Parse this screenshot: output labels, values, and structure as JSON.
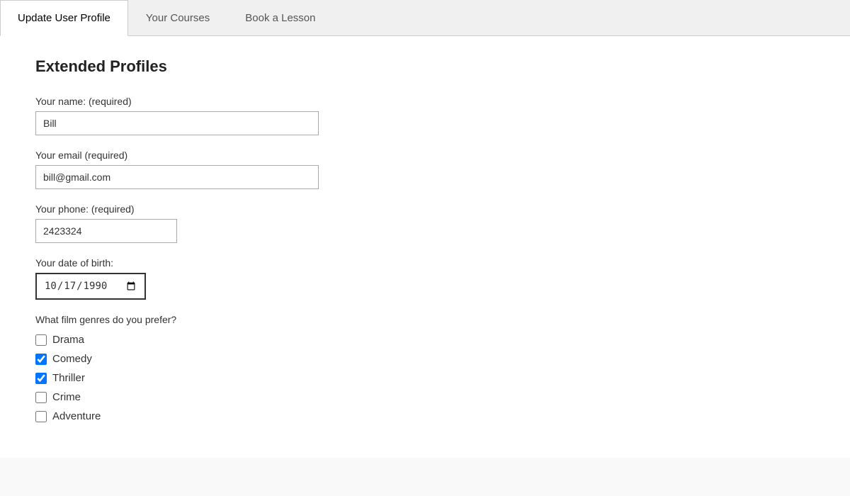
{
  "tabs": [
    {
      "id": "update-user-profile",
      "label": "Update User Profile",
      "active": true
    },
    {
      "id": "your-courses",
      "label": "Your Courses",
      "active": false
    },
    {
      "id": "book-a-lesson",
      "label": "Book a Lesson",
      "active": false
    }
  ],
  "page_title": "Extended Profiles",
  "form": {
    "name_label": "Your name: (required)",
    "name_value": "Bill",
    "email_label": "Your email (required)",
    "email_value": "bill@gmail.com",
    "phone_label": "Your phone: (required)",
    "phone_value": "2423324",
    "dob_label": "Your date of birth:",
    "dob_value": "1990-10-17",
    "dob_display": "10/17/1990",
    "genres_label": "What film genres do you prefer?",
    "genres": [
      {
        "id": "drama",
        "label": "Drama",
        "checked": false
      },
      {
        "id": "comedy",
        "label": "Comedy",
        "checked": true
      },
      {
        "id": "thriller",
        "label": "Thriller",
        "checked": true
      },
      {
        "id": "crime",
        "label": "Crime",
        "checked": false
      },
      {
        "id": "adventure",
        "label": "Adventure",
        "checked": false
      }
    ]
  }
}
